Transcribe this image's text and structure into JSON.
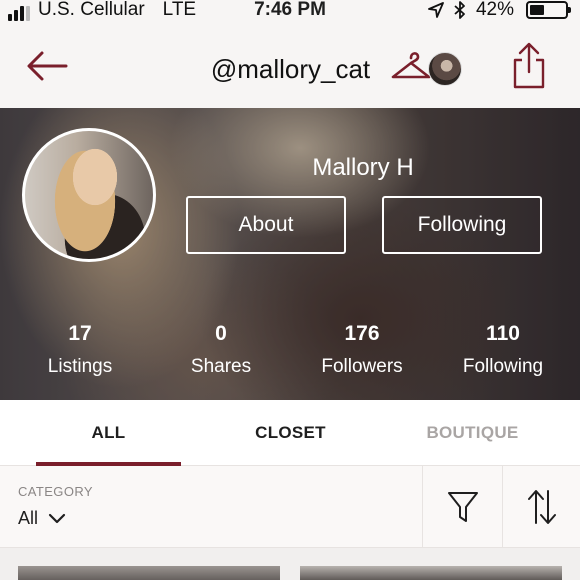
{
  "status_bar": {
    "carrier": "U.S. Cellular",
    "network": "LTE",
    "time": "7:46 PM",
    "battery_percent": "42%",
    "battery_level": 0.42,
    "signal_bars": 3
  },
  "nav": {
    "title": "@mallory_cat",
    "icons": [
      "back-arrow-icon",
      "hanger-icon",
      "share-icon"
    ]
  },
  "profile": {
    "name": "Mallory H",
    "about_label": "About",
    "following_label": "Following",
    "stats": [
      {
        "value": "17",
        "label": "Listings"
      },
      {
        "value": "0",
        "label": "Shares"
      },
      {
        "value": "176",
        "label": "Followers"
      },
      {
        "value": "110",
        "label": "Following"
      }
    ]
  },
  "tabs": [
    {
      "label": "ALL",
      "active": true
    },
    {
      "label": "CLOSET",
      "active": false
    },
    {
      "label": "BOUTIQUE",
      "active": false
    }
  ],
  "filter": {
    "category_label": "CATEGORY",
    "category_value": "All"
  },
  "colors": {
    "accent": "#7a1f2b",
    "inactive_tab": "#a9a5a4",
    "background": "#f7f5f4"
  }
}
